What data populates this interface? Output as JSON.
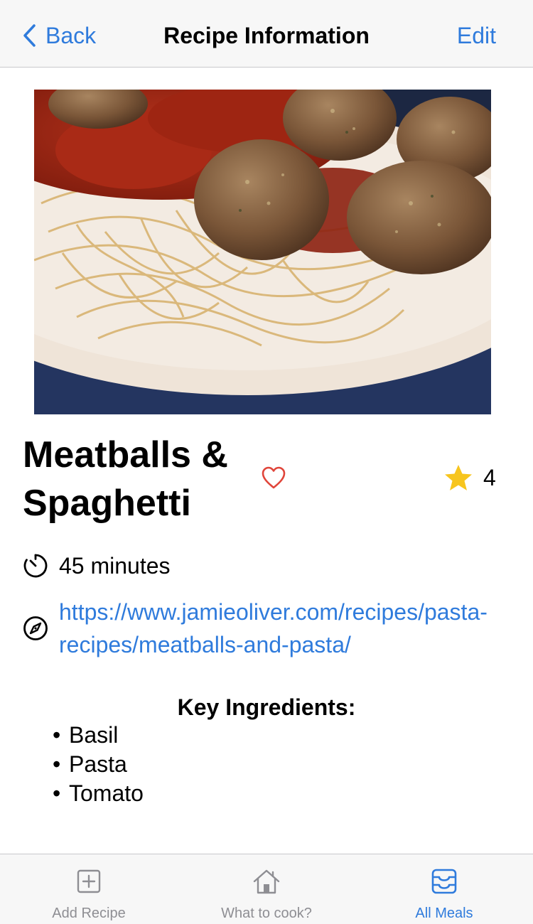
{
  "nav": {
    "back_label": "Back",
    "title": "Recipe Information",
    "edit_label": "Edit"
  },
  "recipe": {
    "title": "Meatballs & Spaghetti",
    "rating": "4",
    "time": "45 minutes",
    "url": "https://www.jamieoliver.com/recipes/pasta-recipes/meatballs-and-pasta/",
    "favorite_icon": "heart-outline-icon",
    "rating_icon": "star-filled-icon"
  },
  "ingredients": {
    "title": "Key Ingredients:",
    "items": [
      "Basil",
      "Pasta",
      "Tomato"
    ]
  },
  "tabbar": {
    "tabs": [
      {
        "label": "Add Recipe",
        "icon": "plus-square-icon",
        "active": false
      },
      {
        "label": "What to cook?",
        "icon": "house-icon",
        "active": false
      },
      {
        "label": "All Meals",
        "icon": "tray-icon",
        "active": true
      }
    ]
  },
  "colors": {
    "accent": "#2f7bdc",
    "heart": "#e0453a",
    "star": "#f7c51e",
    "inactive_tab": "#8e8e93"
  }
}
